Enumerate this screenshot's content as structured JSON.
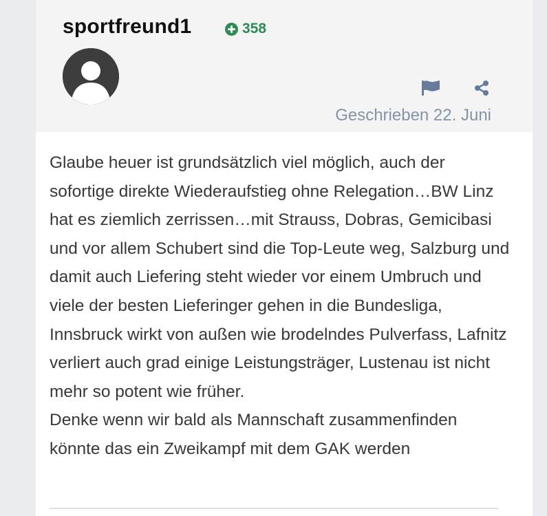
{
  "post": {
    "author": "sportfreund1",
    "reputation": "358",
    "posted_label": "Geschrieben 22. Juni",
    "paragraphs": [
      "Glaube heuer ist grundsätzlich viel möglich, auch der sofortige direkte Wiederaufstieg ohne Relegation…BW Linz hat es ziemlich zerrissen…mit Strauss, Dobras, Gemicibasi und vor allem Schubert sind die Top-Leute weg, Salzburg und damit auch Liefering steht wieder vor einem Umbruch und viele der besten Lieferinger gehen in die Bundesliga, Innsbruck wirkt von außen wie brodelndes Pulverfass, Lafnitz verliert auch grad einige Leistungsträger,  Lustenau ist nicht mehr so potent wie früher.",
      "Denke wenn wir bald als Mannschaft zusammenfinden könnte das ein Zweikampf mit dem GAK werden"
    ]
  },
  "icons": {
    "reputation": "plus-circle-icon",
    "report": "flag-icon",
    "share": "share-icon",
    "avatar": "default-user-avatar"
  },
  "colors": {
    "reputation": "#2e8b57",
    "icon": "#667a99",
    "date": "#8592a8",
    "text": "#383838"
  }
}
